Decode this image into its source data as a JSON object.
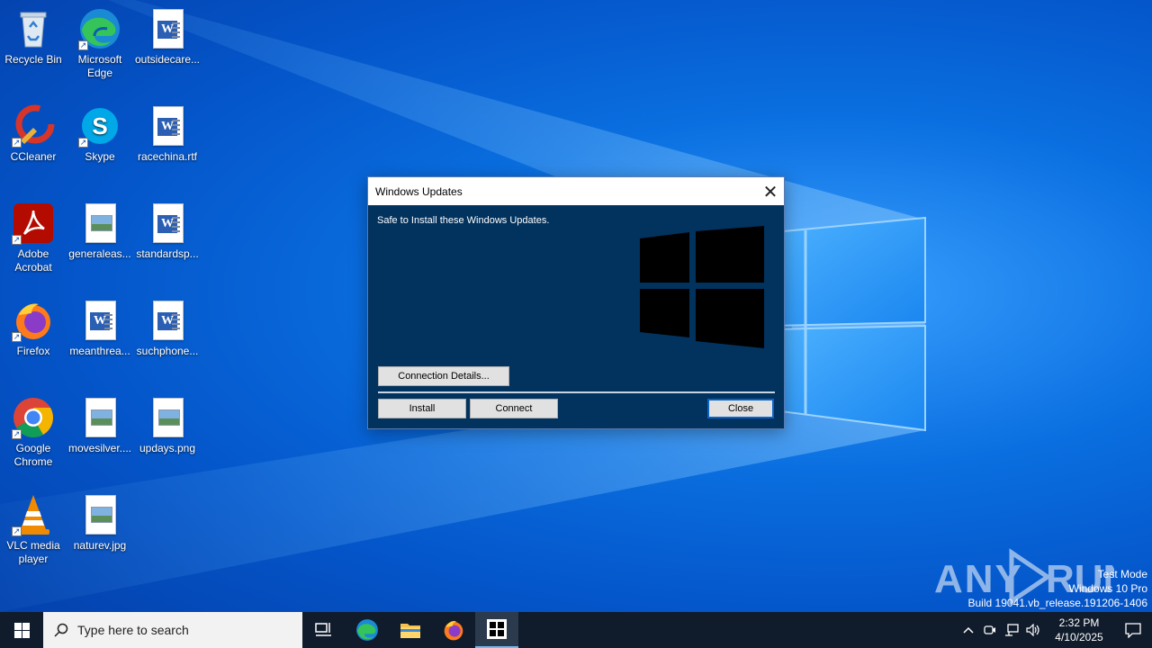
{
  "desktop": {
    "icons": [
      {
        "label": "Recycle Bin"
      },
      {
        "label": "Microsoft Edge"
      },
      {
        "label": "outsidecare..."
      },
      {
        "label": "CCleaner"
      },
      {
        "label": "Skype"
      },
      {
        "label": "racechina.rtf"
      },
      {
        "label": "Adobe Acrobat"
      },
      {
        "label": "generaleas..."
      },
      {
        "label": "standardsp..."
      },
      {
        "label": "Firefox"
      },
      {
        "label": "meanthrea..."
      },
      {
        "label": "suchphone..."
      },
      {
        "label": "Google Chrome"
      },
      {
        "label": "movesilver...."
      },
      {
        "label": "updays.png"
      },
      {
        "label": "VLC media player"
      },
      {
        "label": "naturev.jpg"
      }
    ]
  },
  "dialog": {
    "title": "Windows Updates",
    "message": "Safe to Install these Windows Updates.",
    "connection_details_label": "Connection Details...",
    "install_label": "Install",
    "connect_label": "Connect",
    "close_label": "Close"
  },
  "watermark": {
    "line1": "Test Mode",
    "line2": "Windows 10 Pro",
    "line3": "Build 19041.vb_release.191206-1406"
  },
  "taskbar": {
    "search_placeholder": "Type here to search",
    "time": "2:32 PM",
    "date": "4/10/2025"
  },
  "colors": {
    "dialog_bg": "#02325e",
    "taskbar_bg": "#101c2c",
    "accent": "#0a64c8"
  }
}
